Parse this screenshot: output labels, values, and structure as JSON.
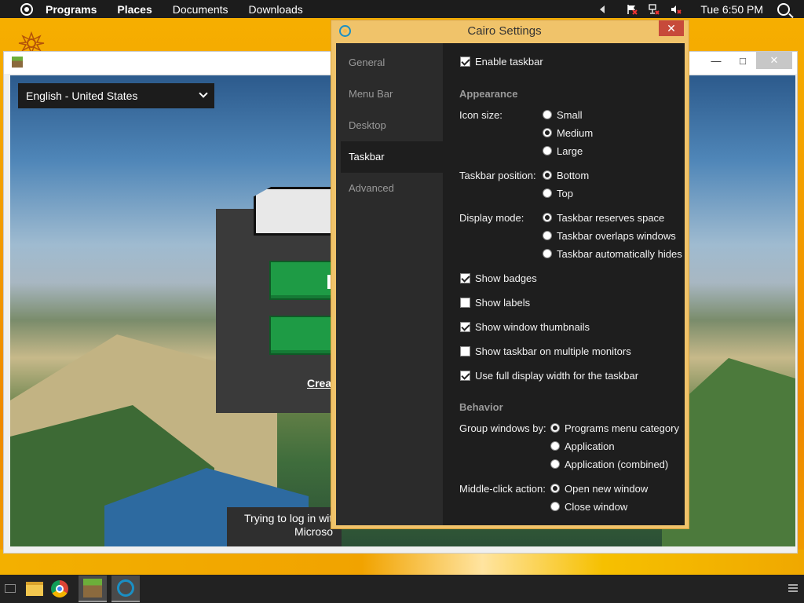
{
  "menubar": {
    "items": [
      "Programs",
      "Places",
      "Documents",
      "Downloads"
    ],
    "clock": "Tue 6:50 PM"
  },
  "minecraft": {
    "language": "English - United States",
    "link_partial": "Crea",
    "status_line1": "Trying to log in wit",
    "status_line2": "Microso"
  },
  "cairo": {
    "title": "Cairo Settings",
    "close": "✕",
    "nav": [
      "General",
      "Menu Bar",
      "Desktop",
      "Taskbar",
      "Advanced"
    ],
    "active_nav": "Taskbar",
    "enable_taskbar": {
      "label": "Enable taskbar",
      "checked": true
    },
    "appearance_heading": "Appearance",
    "icon_size": {
      "label": "Icon size:",
      "options": [
        "Small",
        "Medium",
        "Large"
      ],
      "selected": "Medium"
    },
    "taskbar_position": {
      "label": "Taskbar position:",
      "options": [
        "Bottom",
        "Top"
      ],
      "selected": "Bottom"
    },
    "display_mode": {
      "label": "Display mode:",
      "options": [
        "Taskbar reserves space",
        "Taskbar overlaps windows",
        "Taskbar automatically hides"
      ],
      "selected": "Taskbar reserves space"
    },
    "checks": [
      {
        "label": "Show badges",
        "checked": true
      },
      {
        "label": "Show labels",
        "checked": false
      },
      {
        "label": "Show window thumbnails",
        "checked": true
      },
      {
        "label": "Show taskbar on multiple monitors",
        "checked": false
      },
      {
        "label": "Use full display width for the taskbar",
        "checked": true
      }
    ],
    "behavior_heading": "Behavior",
    "group_windows": {
      "label": "Group windows by:",
      "options": [
        "Programs menu category",
        "Application",
        "Application (combined)"
      ],
      "selected": "Programs menu category"
    },
    "middle_click": {
      "label": "Middle-click action:",
      "options": [
        "Open new window",
        "Close window"
      ],
      "selected": "Open new window"
    }
  },
  "taskbar": {
    "apps": [
      "file-explorer-icon",
      "chrome-icon",
      "minecraft-icon",
      "cairo-icon"
    ],
    "active_app": "minecraft-icon"
  },
  "colors": {
    "desktop": "#f2a700",
    "dialog_frame": "#f0c36a",
    "dialog_bg": "#1e1e1e",
    "close_red": "#c74a3a"
  }
}
